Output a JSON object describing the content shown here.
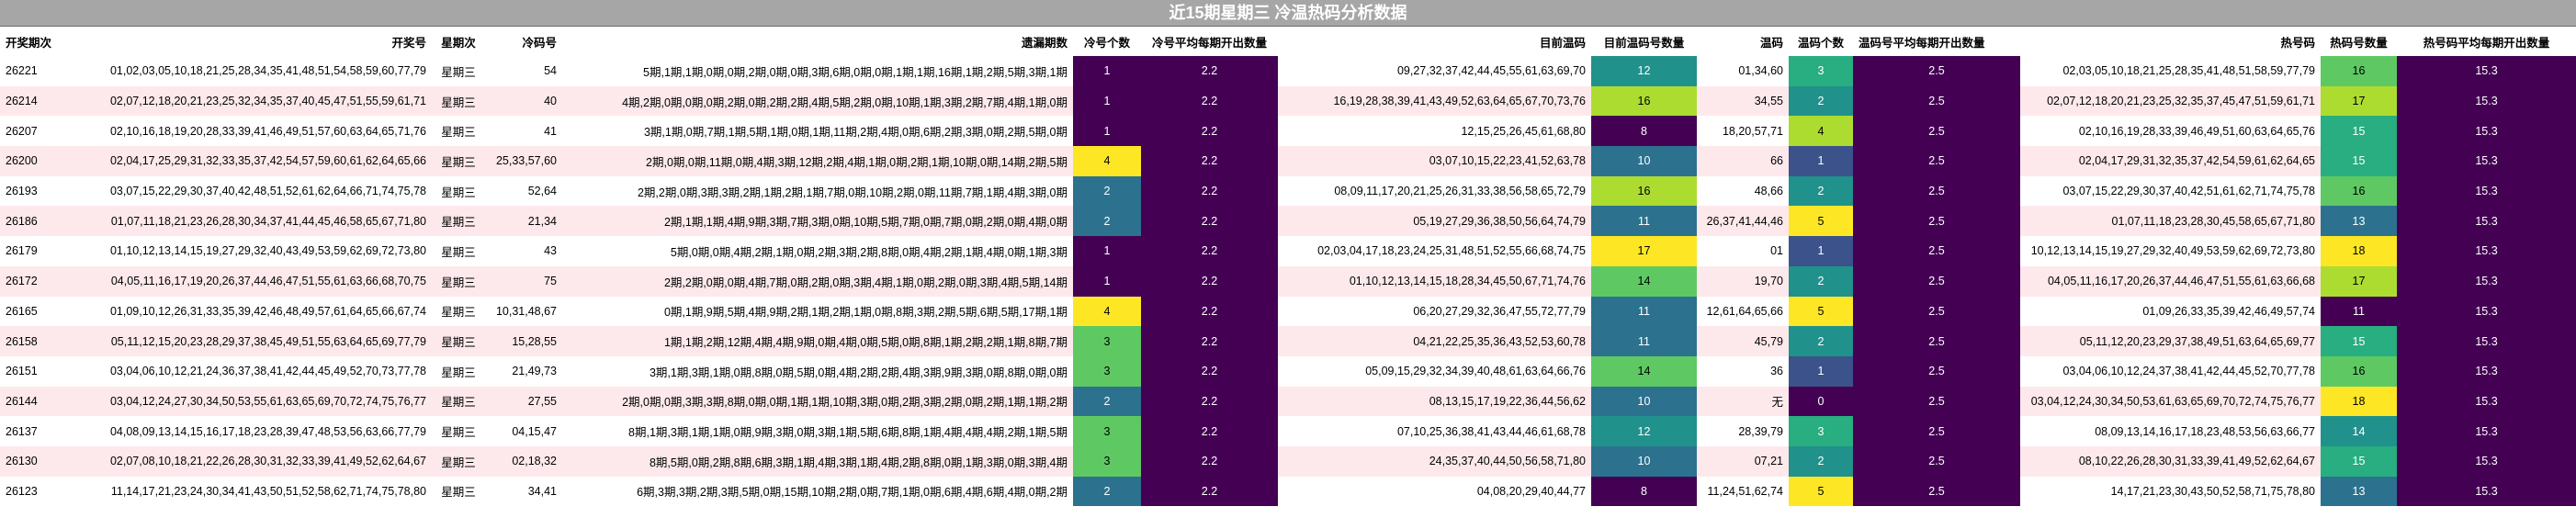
{
  "title": "近15期星期三 冷温热码分析数据",
  "headers": {
    "period": "开奖期次",
    "numbers": "开奖号",
    "weekday": "星期次",
    "cold": "冷码号",
    "missing": "遗漏期数",
    "cold_count": "冷号个数",
    "cold_avg": "冷号平均每期开出数量",
    "target_warm": "目前温码",
    "target_warm_count": "目前温码号数量",
    "warm": "温码",
    "warm_count": "温码个数",
    "warm_avg": "温码号平均每期开出数量",
    "hot": "热号码",
    "hot_count": "热码号数量",
    "hot_avg": "热号码平均每期开出数量"
  },
  "colors": {
    "title_bg": "#a6a6a6",
    "avg_bg": "#440154",
    "row_alt": "#fde9ec",
    "scale": {
      "0": "#440154",
      "1": "#3b528b",
      "2": "#2c728e",
      "3": "#35b779",
      "4": "#fde725"
    }
  },
  "rows": [
    {
      "period": "26221",
      "numbers": "01,02,03,05,10,18,21,25,28,34,35,41,48,51,54,58,59,60,77,79",
      "weekday": "星期三",
      "cold": "54",
      "missing": "5期,1期,1期,0期,0期,2期,0期,0期,3期,6期,0期,0期,1期,1期,16期,1期,2期,5期,3期,1期",
      "cold_count": "1",
      "cold_avg": "2.2",
      "target_warm": "09,27,32,37,42,44,45,55,61,63,69,70",
      "target_warm_count": "12",
      "warm": "01,34,60",
      "warm_count": "3",
      "warm_avg": "2.5",
      "hot": "02,03,05,10,18,21,25,28,35,41,48,51,58,59,77,79",
      "hot_count": "16",
      "hot_avg": "15.3"
    },
    {
      "period": "26214",
      "numbers": "02,07,12,18,20,21,23,25,32,34,35,37,40,45,47,51,55,59,61,71",
      "weekday": "星期三",
      "cold": "40",
      "missing": "4期,2期,0期,0期,0期,2期,0期,2期,2期,4期,5期,2期,0期,10期,1期,3期,2期,7期,4期,1期,0期",
      "cold_count": "1",
      "cold_avg": "2.2",
      "target_warm": "16,19,28,38,39,41,43,49,52,63,64,65,67,70,73,76",
      "target_warm_count": "16",
      "warm": "34,55",
      "warm_count": "2",
      "warm_avg": "2.5",
      "hot": "02,07,12,18,20,21,23,25,32,35,37,45,47,51,59,61,71",
      "hot_count": "17",
      "hot_avg": "15.3"
    },
    {
      "period": "26207",
      "numbers": "02,10,16,18,19,20,28,33,39,41,46,49,51,57,60,63,64,65,71,76",
      "weekday": "星期三",
      "cold": "41",
      "missing": "3期,1期,0期,7期,1期,5期,1期,0期,1期,11期,2期,4期,0期,6期,2期,3期,0期,2期,5期,0期",
      "cold_count": "1",
      "cold_avg": "2.2",
      "target_warm": "12,15,25,26,45,61,68,80",
      "target_warm_count": "8",
      "warm": "18,20,57,71",
      "warm_count": "4",
      "warm_avg": "2.5",
      "hot": "02,10,16,19,28,33,39,46,49,51,60,63,64,65,76",
      "hot_count": "15",
      "hot_avg": "15.3"
    },
    {
      "period": "26200",
      "numbers": "02,04,17,25,29,31,32,33,35,37,42,54,57,59,60,61,62,64,65,66",
      "weekday": "星期三",
      "cold": "25,33,57,60",
      "missing": "2期,0期,0期,11期,0期,4期,3期,12期,2期,4期,1期,0期,2期,1期,10期,0期,14期,2期,5期",
      "cold_count": "4",
      "cold_avg": "2.2",
      "target_warm": "03,07,10,15,22,23,41,52,63,78",
      "target_warm_count": "10",
      "warm": "66",
      "warm_count": "1",
      "warm_avg": "2.5",
      "hot": "02,04,17,29,31,32,35,37,42,54,59,61,62,64,65",
      "hot_count": "15",
      "hot_avg": "15.3"
    },
    {
      "period": "26193",
      "numbers": "03,07,15,22,29,30,37,40,42,48,51,52,61,62,64,66,71,74,75,78",
      "weekday": "星期三",
      "cold": "52,64",
      "missing": "2期,2期,0期,3期,3期,2期,1期,2期,1期,7期,0期,10期,2期,0期,11期,7期,1期,4期,3期,0期",
      "cold_count": "2",
      "cold_avg": "2.2",
      "target_warm": "08,09,11,17,20,21,25,26,31,33,38,56,58,65,72,79",
      "target_warm_count": "16",
      "warm": "48,66",
      "warm_count": "2",
      "warm_avg": "2.5",
      "hot": "03,07,15,22,29,30,37,40,42,51,61,62,71,74,75,78",
      "hot_count": "16",
      "hot_avg": "15.3"
    },
    {
      "period": "26186",
      "numbers": "01,07,11,18,21,23,26,28,30,34,37,41,44,45,46,58,65,67,71,80",
      "weekday": "星期三",
      "cold": "21,34",
      "missing": "2期,1期,1期,4期,9期,3期,7期,3期,0期,10期,5期,7期,0期,7期,0期,2期,0期,4期,0期",
      "cold_count": "2",
      "cold_avg": "2.2",
      "target_warm": "05,19,27,29,36,38,50,56,64,74,79",
      "target_warm_count": "11",
      "warm": "26,37,41,44,46",
      "warm_count": "5",
      "warm_avg": "2.5",
      "hot": "01,07,11,18,23,28,30,45,58,65,67,71,80",
      "hot_count": "13",
      "hot_avg": "15.3"
    },
    {
      "period": "26179",
      "numbers": "01,10,12,13,14,15,19,27,29,32,40,43,49,53,59,62,69,72,73,80",
      "weekday": "星期三",
      "cold": "43",
      "missing": "5期,0期,0期,4期,2期,1期,0期,2期,3期,2期,8期,0期,4期,2期,1期,4期,0期,1期,3期",
      "cold_count": "1",
      "cold_avg": "2.2",
      "target_warm": "02,03,04,17,18,23,24,25,31,48,51,52,55,66,68,74,75",
      "target_warm_count": "17",
      "warm": "01",
      "warm_count": "1",
      "warm_avg": "2.5",
      "hot": "10,12,13,14,15,19,27,29,32,40,49,53,59,62,69,72,73,80",
      "hot_count": "18",
      "hot_avg": "15.3"
    },
    {
      "period": "26172",
      "numbers": "04,05,11,16,17,19,20,26,37,44,46,47,51,55,61,63,66,68,70,75",
      "weekday": "星期三",
      "cold": "75",
      "missing": "2期,2期,0期,0期,4期,7期,0期,2期,0期,3期,4期,1期,0期,2期,0期,3期,4期,5期,14期",
      "cold_count": "1",
      "cold_avg": "2.2",
      "target_warm": "01,10,12,13,14,15,18,28,34,45,50,67,71,74,76",
      "target_warm_count": "14",
      "warm": "19,70",
      "warm_count": "2",
      "warm_avg": "2.5",
      "hot": "04,05,11,16,17,20,26,37,44,46,47,51,55,61,63,66,68",
      "hot_count": "17",
      "hot_avg": "15.3"
    },
    {
      "period": "26165",
      "numbers": "01,09,10,12,26,31,33,35,39,42,46,48,49,57,61,64,65,66,67,74",
      "weekday": "星期三",
      "cold": "10,31,48,67",
      "missing": "0期,1期,9期,5期,4期,9期,2期,1期,2期,1期,0期,8期,3期,2期,5期,6期,5期,17期,1期",
      "cold_count": "4",
      "cold_avg": "2.2",
      "target_warm": "06,20,27,29,32,36,47,55,72,77,79",
      "target_warm_count": "11",
      "warm": "12,61,64,65,66",
      "warm_count": "5",
      "warm_avg": "2.5",
      "hot": "01,09,26,33,35,39,42,46,49,57,74",
      "hot_count": "11",
      "hot_avg": "15.3"
    },
    {
      "period": "26158",
      "numbers": "05,11,12,15,20,23,28,29,37,38,45,49,51,55,63,64,65,69,77,79",
      "weekday": "星期三",
      "cold": "15,28,55",
      "missing": "1期,1期,2期,12期,4期,4期,9期,0期,4期,0期,5期,0期,8期,1期,2期,2期,1期,8期,7期",
      "cold_count": "3",
      "cold_avg": "2.2",
      "target_warm": "04,21,22,25,35,36,43,52,53,60,78",
      "target_warm_count": "11",
      "warm": "45,79",
      "warm_count": "2",
      "warm_avg": "2.5",
      "hot": "05,11,12,20,23,29,37,38,49,51,63,64,65,69,77",
      "hot_count": "15",
      "hot_avg": "15.3"
    },
    {
      "period": "26151",
      "numbers": "03,04,06,10,12,21,24,36,37,38,41,42,44,45,49,52,70,73,77,78",
      "weekday": "星期三",
      "cold": "21,49,73",
      "missing": "3期,1期,3期,1期,0期,8期,0期,5期,0期,4期,2期,2期,4期,3期,9期,3期,0期,8期,0期,0期",
      "cold_count": "3",
      "cold_avg": "2.2",
      "target_warm": "05,09,15,29,32,34,39,40,48,61,63,64,66,76",
      "target_warm_count": "14",
      "warm": "36",
      "warm_count": "1",
      "warm_avg": "2.5",
      "hot": "03,04,06,10,12,24,37,38,41,42,44,45,52,70,77,78",
      "hot_count": "16",
      "hot_avg": "15.3"
    },
    {
      "period": "26144",
      "numbers": "03,04,12,24,27,30,34,50,53,55,61,63,65,69,70,72,74,75,76,77",
      "weekday": "星期三",
      "cold": "27,55",
      "missing": "2期,0期,0期,3期,3期,8期,0期,0期,1期,1期,10期,3期,0期,2期,3期,2期,0期,2期,1期,1期,2期",
      "cold_count": "2",
      "cold_avg": "2.2",
      "target_warm": "08,13,15,17,19,22,36,44,56,62",
      "target_warm_count": "10",
      "warm": "无",
      "warm_count": "0",
      "warm_avg": "2.5",
      "hot": "03,04,12,24,30,34,50,53,61,63,65,69,70,72,74,75,76,77",
      "hot_count": "18",
      "hot_avg": "15.3"
    },
    {
      "period": "26137",
      "numbers": "04,08,09,13,14,15,16,17,18,23,28,39,47,48,53,56,63,66,77,79",
      "weekday": "星期三",
      "cold": "04,15,47",
      "missing": "8期,1期,3期,1期,1期,0期,9期,3期,0期,3期,1期,5期,6期,8期,1期,4期,4期,4期,2期,1期,5期",
      "cold_count": "3",
      "cold_avg": "2.2",
      "target_warm": "07,10,25,36,38,41,43,44,46,61,68,78",
      "target_warm_count": "12",
      "warm": "28,39,79",
      "warm_count": "3",
      "warm_avg": "2.5",
      "hot": "08,09,13,14,16,17,18,23,48,53,56,63,66,77",
      "hot_count": "14",
      "hot_avg": "15.3"
    },
    {
      "period": "26130",
      "numbers": "02,07,08,10,18,21,22,26,28,30,31,32,33,39,41,49,52,62,64,67",
      "weekday": "星期三",
      "cold": "02,18,32",
      "missing": "8期,5期,0期,2期,8期,6期,3期,1期,4期,3期,1期,4期,2期,8期,0期,1期,3期,0期,3期,4期",
      "cold_count": "3",
      "cold_avg": "2.2",
      "target_warm": "24,35,37,40,44,50,56,58,71,80",
      "target_warm_count": "10",
      "warm": "07,21",
      "warm_count": "2",
      "warm_avg": "2.5",
      "hot": "08,10,22,26,28,30,31,33,39,41,49,52,62,64,67",
      "hot_count": "15",
      "hot_avg": "15.3"
    },
    {
      "period": "26123",
      "numbers": "11,14,17,21,23,24,30,34,41,43,50,51,52,58,62,71,74,75,78,80",
      "weekday": "星期三",
      "cold": "34,41",
      "missing": "6期,3期,3期,2期,3期,5期,0期,15期,10期,2期,0期,7期,1期,0期,6期,4期,6期,4期,0期,2期",
      "cold_count": "2",
      "cold_avg": "2.2",
      "target_warm": "04,08,20,29,40,44,77",
      "target_warm_count": "8",
      "warm": "11,24,51,62,74",
      "warm_count": "5",
      "warm_avg": "2.5",
      "hot": "14,17,21,23,30,43,50,52,58,71,75,78,80",
      "hot_count": "13",
      "hot_avg": "15.3"
    }
  ]
}
